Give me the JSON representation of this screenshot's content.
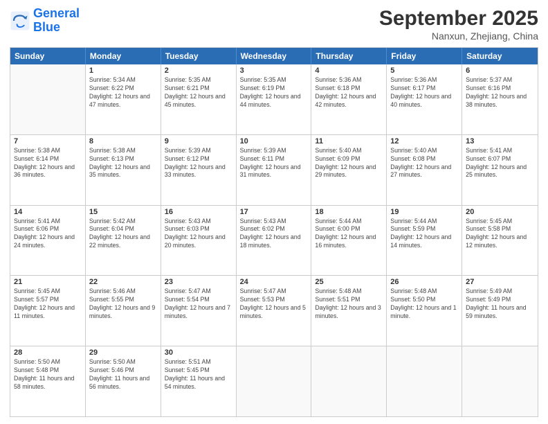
{
  "header": {
    "logo_text_general": "General",
    "logo_text_blue": "Blue",
    "month_title": "September 2025",
    "subtitle": "Nanxun, Zhejiang, China"
  },
  "weekdays": [
    "Sunday",
    "Monday",
    "Tuesday",
    "Wednesday",
    "Thursday",
    "Friday",
    "Saturday"
  ],
  "weeks": [
    [
      {
        "day": "",
        "empty": true
      },
      {
        "day": "1",
        "sunrise": "5:34 AM",
        "sunset": "6:22 PM",
        "daylight": "12 hours and 47 minutes."
      },
      {
        "day": "2",
        "sunrise": "5:35 AM",
        "sunset": "6:21 PM",
        "daylight": "12 hours and 45 minutes."
      },
      {
        "day": "3",
        "sunrise": "5:35 AM",
        "sunset": "6:19 PM",
        "daylight": "12 hours and 44 minutes."
      },
      {
        "day": "4",
        "sunrise": "5:36 AM",
        "sunset": "6:18 PM",
        "daylight": "12 hours and 42 minutes."
      },
      {
        "day": "5",
        "sunrise": "5:36 AM",
        "sunset": "6:17 PM",
        "daylight": "12 hours and 40 minutes."
      },
      {
        "day": "6",
        "sunrise": "5:37 AM",
        "sunset": "6:16 PM",
        "daylight": "12 hours and 38 minutes."
      }
    ],
    [
      {
        "day": "7",
        "sunrise": "5:38 AM",
        "sunset": "6:14 PM",
        "daylight": "12 hours and 36 minutes."
      },
      {
        "day": "8",
        "sunrise": "5:38 AM",
        "sunset": "6:13 PM",
        "daylight": "12 hours and 35 minutes."
      },
      {
        "day": "9",
        "sunrise": "5:39 AM",
        "sunset": "6:12 PM",
        "daylight": "12 hours and 33 minutes."
      },
      {
        "day": "10",
        "sunrise": "5:39 AM",
        "sunset": "6:11 PM",
        "daylight": "12 hours and 31 minutes."
      },
      {
        "day": "11",
        "sunrise": "5:40 AM",
        "sunset": "6:09 PM",
        "daylight": "12 hours and 29 minutes."
      },
      {
        "day": "12",
        "sunrise": "5:40 AM",
        "sunset": "6:08 PM",
        "daylight": "12 hours and 27 minutes."
      },
      {
        "day": "13",
        "sunrise": "5:41 AM",
        "sunset": "6:07 PM",
        "daylight": "12 hours and 25 minutes."
      }
    ],
    [
      {
        "day": "14",
        "sunrise": "5:41 AM",
        "sunset": "6:06 PM",
        "daylight": "12 hours and 24 minutes."
      },
      {
        "day": "15",
        "sunrise": "5:42 AM",
        "sunset": "6:04 PM",
        "daylight": "12 hours and 22 minutes."
      },
      {
        "day": "16",
        "sunrise": "5:43 AM",
        "sunset": "6:03 PM",
        "daylight": "12 hours and 20 minutes."
      },
      {
        "day": "17",
        "sunrise": "5:43 AM",
        "sunset": "6:02 PM",
        "daylight": "12 hours and 18 minutes."
      },
      {
        "day": "18",
        "sunrise": "5:44 AM",
        "sunset": "6:00 PM",
        "daylight": "12 hours and 16 minutes."
      },
      {
        "day": "19",
        "sunrise": "5:44 AM",
        "sunset": "5:59 PM",
        "daylight": "12 hours and 14 minutes."
      },
      {
        "day": "20",
        "sunrise": "5:45 AM",
        "sunset": "5:58 PM",
        "daylight": "12 hours and 12 minutes."
      }
    ],
    [
      {
        "day": "21",
        "sunrise": "5:45 AM",
        "sunset": "5:57 PM",
        "daylight": "12 hours and 11 minutes."
      },
      {
        "day": "22",
        "sunrise": "5:46 AM",
        "sunset": "5:55 PM",
        "daylight": "12 hours and 9 minutes."
      },
      {
        "day": "23",
        "sunrise": "5:47 AM",
        "sunset": "5:54 PM",
        "daylight": "12 hours and 7 minutes."
      },
      {
        "day": "24",
        "sunrise": "5:47 AM",
        "sunset": "5:53 PM",
        "daylight": "12 hours and 5 minutes."
      },
      {
        "day": "25",
        "sunrise": "5:48 AM",
        "sunset": "5:51 PM",
        "daylight": "12 hours and 3 minutes."
      },
      {
        "day": "26",
        "sunrise": "5:48 AM",
        "sunset": "5:50 PM",
        "daylight": "12 hours and 1 minute."
      },
      {
        "day": "27",
        "sunrise": "5:49 AM",
        "sunset": "5:49 PM",
        "daylight": "11 hours and 59 minutes."
      }
    ],
    [
      {
        "day": "28",
        "sunrise": "5:50 AM",
        "sunset": "5:48 PM",
        "daylight": "11 hours and 58 minutes."
      },
      {
        "day": "29",
        "sunrise": "5:50 AM",
        "sunset": "5:46 PM",
        "daylight": "11 hours and 56 minutes."
      },
      {
        "day": "30",
        "sunrise": "5:51 AM",
        "sunset": "5:45 PM",
        "daylight": "11 hours and 54 minutes."
      },
      {
        "day": "",
        "empty": true
      },
      {
        "day": "",
        "empty": true
      },
      {
        "day": "",
        "empty": true
      },
      {
        "day": "",
        "empty": true
      }
    ]
  ]
}
